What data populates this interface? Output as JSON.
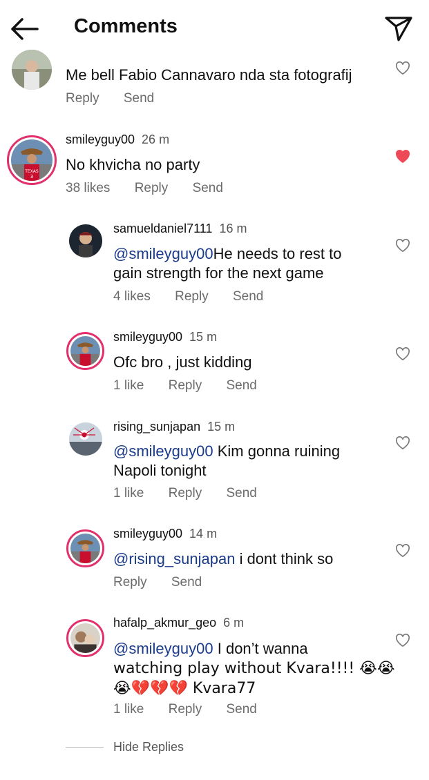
{
  "header": {
    "title": "Comments"
  },
  "comments": [
    {
      "text": "Me bell Fabio Cannavaro nda sta fotografij",
      "reply": "Reply",
      "send": "Send"
    },
    {
      "username": "smileyguy00",
      "time": "26 m",
      "text": "No khvicha no party",
      "likes": "38 likes",
      "reply": "Reply",
      "send": "Send",
      "liked": true
    },
    {
      "username": "samueldaniel7111",
      "time": "16 m",
      "mention": "@smileyguy00",
      "text1": "He needs to rest to",
      "text2": "gain strength for the next game",
      "likes": "4 likes",
      "reply": "Reply",
      "send": "Send"
    },
    {
      "username": "smileyguy00",
      "time": "15 m",
      "text": "Ofc bro , just kidding",
      "likes": "1 like",
      "reply": "Reply",
      "send": "Send"
    },
    {
      "username": "rising_sunjapan",
      "time": "15 m",
      "mention": "@smileyguy00",
      "text1": " Kim gonna ruining",
      "text2": "Napoli tonight",
      "likes": "1 like",
      "reply": "Reply",
      "send": "Send"
    },
    {
      "username": "smileyguy00",
      "time": "14 m",
      "mention": "@rising_sunjapan",
      "text1": " i dont think so",
      "reply": "Reply",
      "send": "Send"
    },
    {
      "username": "hafalp_akmur_geo",
      "time": "6 m",
      "mention": "@smileyguy00",
      "text1": " I don’t wanna",
      "text2": "watching play without Kvara!!!! 😭😭",
      "text3": "😭💔💔💔 Kvara77",
      "likes": "1 like",
      "reply": "Reply",
      "send": "Send"
    }
  ],
  "hide_replies": "Hide Replies",
  "colors": {
    "liked_heart": "#ed4956",
    "mention": "#1a3b8a",
    "story_ring": "#e1306c"
  }
}
